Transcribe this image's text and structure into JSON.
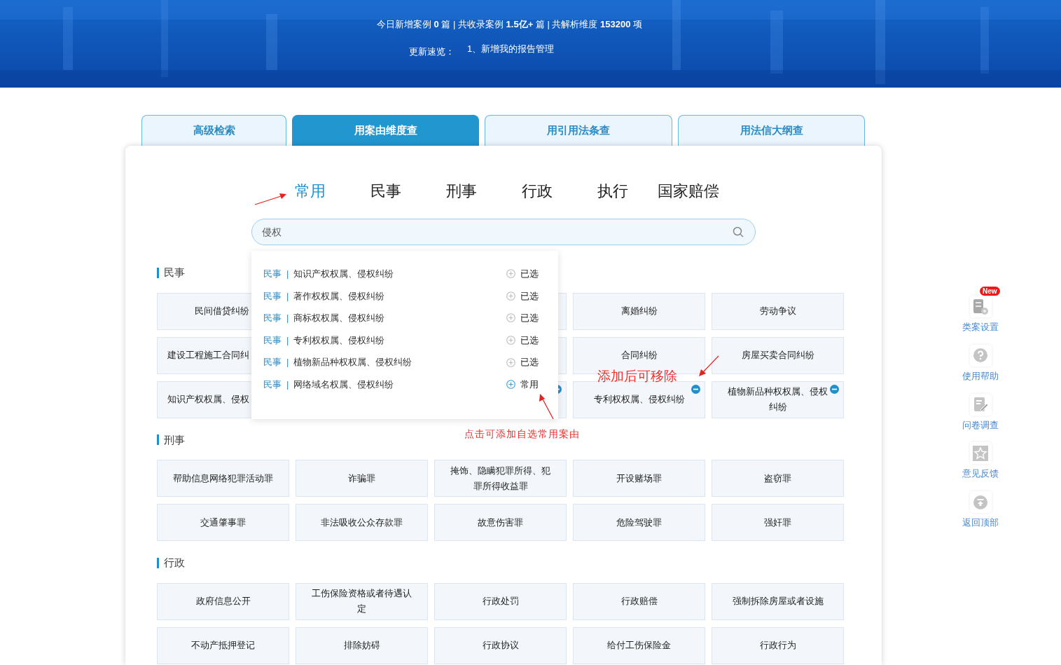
{
  "header": {
    "stats": "今日新增案例 **0** 篇 | 共收录案例 **1.5亿+** 篇 | 共解析维度 **153200** 项",
    "updates_label": "更新速览：",
    "updates": [
      "1、新增我的报告管理"
    ]
  },
  "search_modes": [
    {
      "label": "高级检索",
      "selected": false
    },
    {
      "label": "用案由维度查",
      "selected": true
    },
    {
      "label": "用引用法条查",
      "selected": false
    },
    {
      "label": "用法信大纲查",
      "selected": false
    }
  ],
  "categories": [
    {
      "label": "常用",
      "selected": true
    },
    {
      "label": "民事",
      "selected": false
    },
    {
      "label": "刑事",
      "selected": false
    },
    {
      "label": "行政",
      "selected": false
    },
    {
      "label": "执行",
      "selected": false
    },
    {
      "label": "国家赔偿",
      "selected": false
    }
  ],
  "search": {
    "value": "侵权"
  },
  "sections": [
    {
      "title": "民事",
      "cells": [
        {
          "label": "民间借贷纠纷",
          "removable": false
        },
        {
          "removable": false
        },
        {
          "label": "离婚纠纷",
          "removable": false
        },
        {
          "label": "劳动争议",
          "removable": false
        },
        {
          "label": "建设工程施工合同纠",
          "removable": false
        },
        {
          "removable": false
        },
        {
          "label": "合同纠纷",
          "removable": false
        },
        {
          "label": "房屋买卖合同纠纷",
          "removable": false
        },
        {
          "label": "知识产权权属、侵权",
          "removable": false
        },
        {
          "removable": true
        },
        {
          "label": "专利权权属、侵权纠纷",
          "removable": true
        },
        {
          "label": "植物新品种权权属、侵权纠纷",
          "removable": true
        }
      ]
    },
    {
      "title": "刑事",
      "cells": [
        {
          "label": "帮助信息网络犯罪活动罪",
          "removable": false
        },
        {
          "label": "诈骗罪",
          "removable": false
        },
        {
          "label": "掩饰、隐瞒犯罪所得、犯罪所得收益罪",
          "removable": false
        },
        {
          "label": "开设赌场罪",
          "removable": false
        },
        {
          "label": "盗窃罪",
          "removable": false
        },
        {
          "label": "交通肇事罪",
          "removable": false
        },
        {
          "label": "非法吸收公众存款罪",
          "removable": false
        },
        {
          "label": "故意伤害罪",
          "removable": false
        },
        {
          "label": "危险驾驶罪",
          "removable": false
        },
        {
          "label": "强奸罪",
          "removable": false
        }
      ]
    },
    {
      "title": "行政",
      "cells": [
        {
          "label": "政府信息公开",
          "removable": false
        },
        {
          "label": "工伤保险资格或者待遇认定",
          "removable": false
        },
        {
          "label": "行政处罚",
          "removable": false
        },
        {
          "label": "行政赔偿",
          "removable": false
        },
        {
          "label": "强制拆除房屋或者设施",
          "removable": false
        },
        {
          "label": "不动产抵押登记",
          "removable": false
        },
        {
          "label": "排除妨碍",
          "removable": false
        },
        {
          "label": "行政协议",
          "removable": false
        },
        {
          "label": "给付工伤保险金",
          "removable": false
        },
        {
          "label": "行政行为",
          "removable": false
        }
      ]
    }
  ],
  "dropdown": {
    "items": [
      {
        "category": "民事",
        "separator": "|",
        "name": "知识产权权属、侵权纠纷",
        "added": true,
        "action": "已选"
      },
      {
        "category": "民事",
        "separator": "|",
        "name": "著作权权属、侵权纠纷",
        "added": true,
        "action": "已选"
      },
      {
        "category": "民事",
        "separator": "|",
        "name": "商标权权属、侵权纠纷",
        "added": true,
        "action": "已选"
      },
      {
        "category": "民事",
        "separator": "|",
        "name": "专利权权属、侵权纠纷",
        "added": true,
        "action": "已选"
      },
      {
        "category": "民事",
        "separator": "|",
        "name": "植物新品种权权属、侵权纠纷",
        "added": true,
        "action": "已选"
      },
      {
        "category": "民事",
        "separator": "|",
        "name": "网络域名权属、侵权纠纷",
        "added": false,
        "action": "常用"
      }
    ]
  },
  "annotations": [
    {
      "text": "添加后可移除"
    },
    {
      "text": "点击可添加自选常用案由"
    }
  ],
  "side_tools": [
    {
      "kind": "settings",
      "label": "类案设置",
      "badge": "New"
    },
    {
      "kind": "help",
      "label": "使用帮助"
    },
    {
      "kind": "survey",
      "label": "问卷调查"
    },
    {
      "kind": "feedback",
      "label": "意见反馈"
    },
    {
      "kind": "top",
      "label": "返回顶部"
    }
  ]
}
